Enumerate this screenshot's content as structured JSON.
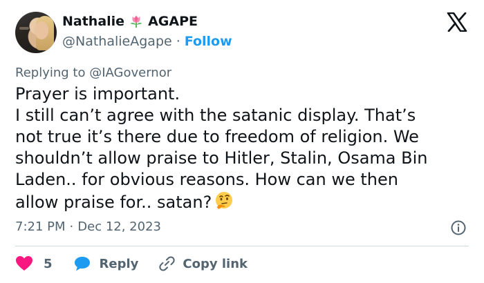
{
  "author": {
    "name_first": "Nathalie",
    "name_last": "AGAPE",
    "handle": "@NathalieAgape",
    "separator": "·",
    "follow_label": "Follow"
  },
  "reply": {
    "prefix": "Replying to",
    "mention": "@IAGovernor"
  },
  "tweet": {
    "lines": [
      "Prayer is important.",
      "I still can’t agree with the satanic display. That’s",
      "not true it’s there due to freedom of religion. We",
      "shouldn’t allow praise to Hitler, Stalin, Osama Bin",
      "Laden.. for obvious reasons. How can we then",
      "allow praise for.. satan?"
    ],
    "emoji": "thinking-face-icon"
  },
  "meta": {
    "time": "7:21 PM",
    "separator": "·",
    "date": "Dec 12, 2023"
  },
  "actions": {
    "like_count": "5",
    "reply_label": "Reply",
    "copy_label": "Copy link"
  },
  "colors": {
    "accent": "#1d9bf0",
    "like": "#f91880",
    "muted": "#536471",
    "text": "#0f1419",
    "divider": "#cfd9de"
  },
  "icons": [
    "x-logo-icon",
    "tulip-icon",
    "info-icon",
    "heart-icon",
    "reply-bubble-icon",
    "link-icon"
  ]
}
